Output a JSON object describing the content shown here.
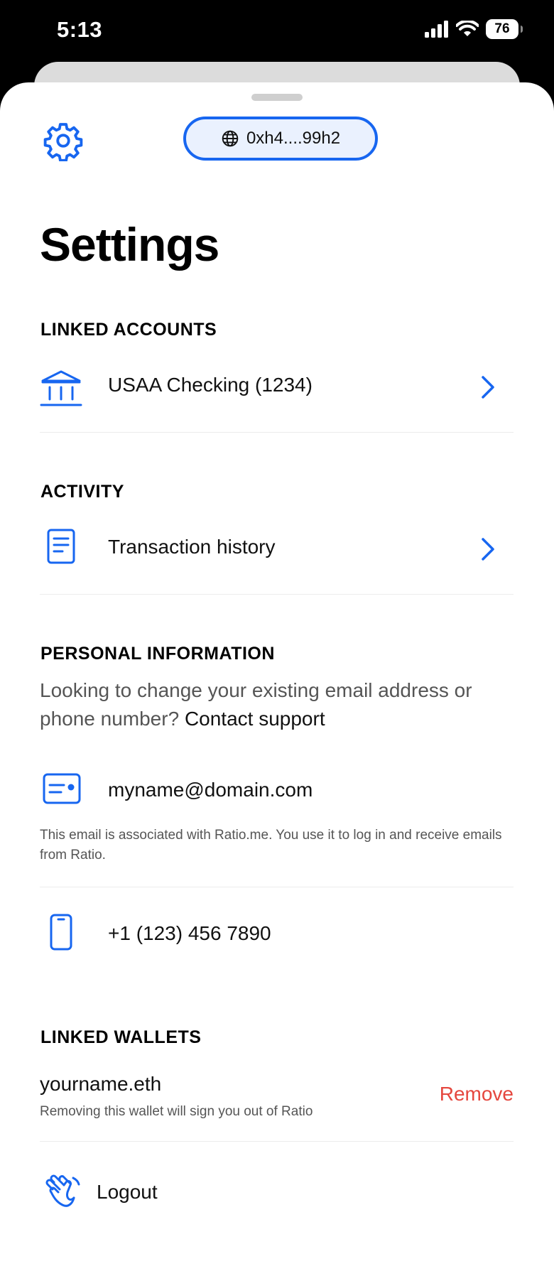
{
  "status_bar": {
    "time": "5:13",
    "battery": "76"
  },
  "header": {
    "wallet_address": "0xh4....99h2"
  },
  "title": "Settings",
  "linked_accounts": {
    "header": "LINKED ACCOUNTS",
    "account_label": "USAA Checking  (1234)"
  },
  "activity": {
    "header": "ACTIVITY",
    "history_label": "Transaction history"
  },
  "personal_information": {
    "header": "PERSONAL INFORMATION",
    "info_text": "Looking to change your existing email address or phone number?",
    "contact_support": "Contact support",
    "email": "myname@domain.com",
    "email_note": "This email is associated with Ratio.me. You use it to log in and receive emails from Ratio.",
    "phone": "+1 (123) 456 7890"
  },
  "linked_wallets": {
    "header": "LINKED WALLETS",
    "wallet_name": "yourname.eth",
    "wallet_note": "Removing this wallet will sign you out of Ratio",
    "remove_label": "Remove"
  },
  "logout_label": "Logout",
  "colors": {
    "accent": "#1766f0",
    "danger": "#e5473e",
    "divider": "#ececec"
  }
}
